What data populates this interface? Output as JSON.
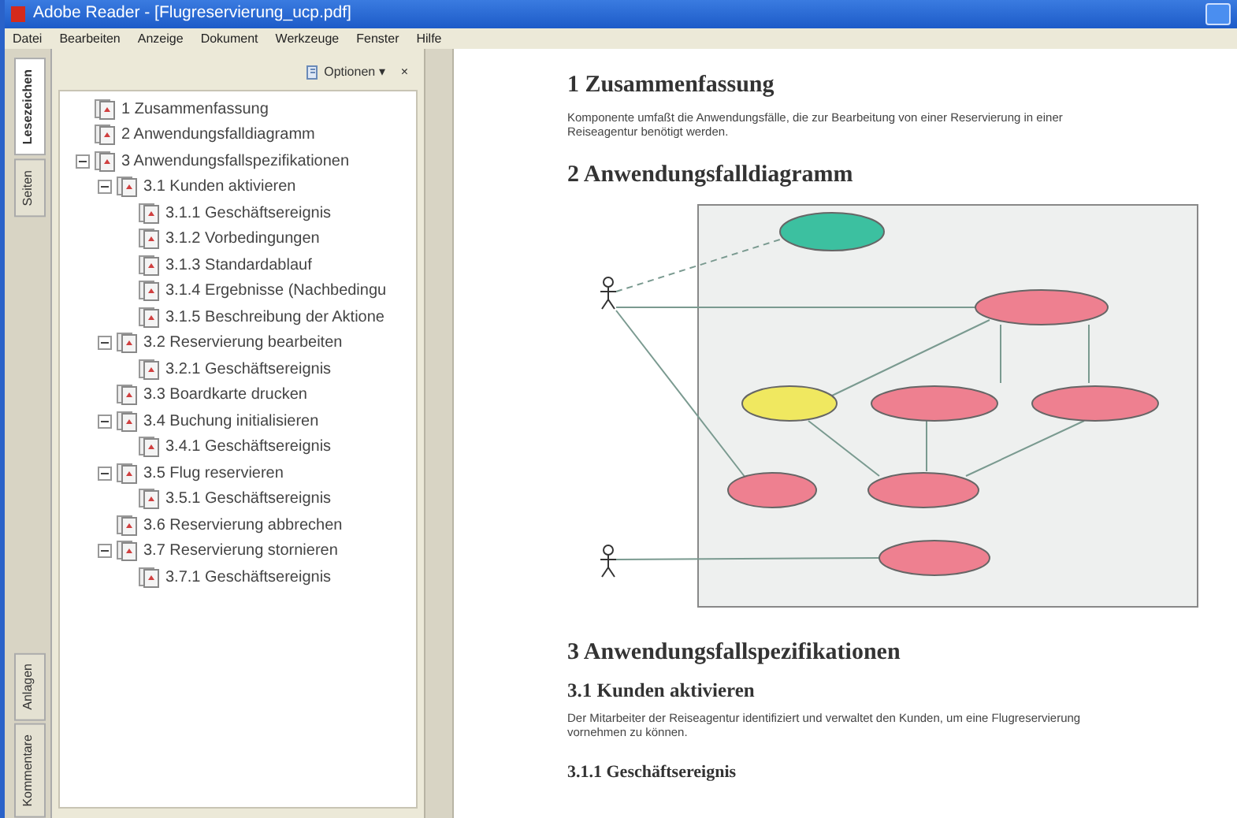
{
  "window": {
    "title": "Adobe Reader - [Flugreservierung_ucp.pdf]"
  },
  "menu": [
    "Datei",
    "Bearbeiten",
    "Anzeige",
    "Dokument",
    "Werkzeuge",
    "Fenster",
    "Hilfe"
  ],
  "side_tabs": [
    {
      "label": "Lesezeichen",
      "selected": true
    },
    {
      "label": "Seiten",
      "selected": false
    },
    {
      "label": "Anlagen",
      "selected": false
    },
    {
      "label": "Kommentare",
      "selected": false
    }
  ],
  "bookmarks_panel": {
    "options_label": "Optionen ▾",
    "close_label": "×",
    "tree": [
      {
        "label": "1 Zusammenfassung"
      },
      {
        "label": "2 Anwendungsfalldiagramm"
      },
      {
        "label": "3 Anwendungsfallspezifikationen",
        "expanded": true,
        "children": [
          {
            "label": "3.1 Kunden aktivieren",
            "expanded": true,
            "children": [
              {
                "label": "3.1.1 Geschäftsereignis"
              },
              {
                "label": "3.1.2 Vorbedingungen"
              },
              {
                "label": "3.1.3 Standardablauf"
              },
              {
                "label": "3.1.4 Ergebnisse (Nachbedingu"
              },
              {
                "label": "3.1.5 Beschreibung der Aktione"
              }
            ]
          },
          {
            "label": "3.2 Reservierung bearbeiten",
            "expanded": true,
            "children": [
              {
                "label": "3.2.1 Geschäftsereignis"
              }
            ]
          },
          {
            "label": "3.3 Boardkarte drucken"
          },
          {
            "label": "3.4 Buchung initialisieren",
            "expanded": true,
            "children": [
              {
                "label": "3.4.1 Geschäftsereignis"
              }
            ]
          },
          {
            "label": "3.5 Flug reservieren",
            "expanded": true,
            "children": [
              {
                "label": "3.5.1 Geschäftsereignis"
              }
            ]
          },
          {
            "label": "3.6 Reservierung abbrechen"
          },
          {
            "label": "3.7 Reservierung stornieren",
            "expanded": true,
            "children": [
              {
                "label": "3.7.1 Geschäftsereignis"
              }
            ]
          }
        ]
      }
    ]
  },
  "document": [
    {
      "kind": "h1",
      "text": "1 Zusammenfassung"
    },
    {
      "kind": "p",
      "text": "Komponente umfaßt die Anwendungsfälle, die zur Bearbeitung von einer Reservierung in einer Reiseagentur benötigt werden."
    },
    {
      "kind": "h1",
      "text": "2 Anwendungsfalldiagramm"
    },
    {
      "kind": "diagram"
    },
    {
      "kind": "h1",
      "text": "3 Anwendungsfallspezifikationen"
    },
    {
      "kind": "h2",
      "text": "3.1 Kunden aktivieren"
    },
    {
      "kind": "p",
      "text": "Der Mitarbeiter der Reiseagentur identifiziert und verwaltet den Kunden, um eine Flugreservierung vornehmen zu können."
    },
    {
      "kind": "h3",
      "text": "3.1.1 Geschäftsereignis"
    }
  ]
}
